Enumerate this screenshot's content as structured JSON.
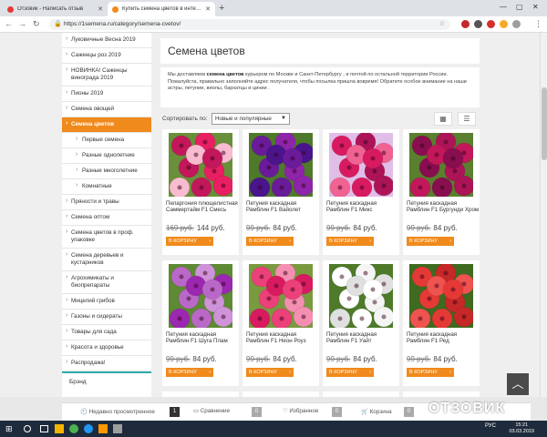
{
  "browser": {
    "tabs": [
      {
        "title": "Отзовик - Написать отзыв",
        "active": false,
        "favicon_color": "#e53935"
      },
      {
        "title": "Купить семена цветов в интер...",
        "active": true,
        "favicon_color": "#f08a1c"
      }
    ],
    "url": "https://1semena.ru/category/semena-cvetov/",
    "accent": "#f08a1c"
  },
  "sidebar": {
    "items": [
      {
        "label": "Луковичные Весна 2019",
        "active": false,
        "sub": false
      },
      {
        "label": "Саженцы роз 2019",
        "active": false,
        "sub": false
      },
      {
        "label": "НОВИНКА! Саженцы винограда 2019",
        "active": false,
        "sub": false
      },
      {
        "label": "Пионы 2019",
        "active": false,
        "sub": false
      },
      {
        "label": "Семена овощей",
        "active": false,
        "sub": false
      },
      {
        "label": "Семена цветов",
        "active": true,
        "sub": false
      },
      {
        "label": "Первые семена",
        "active": false,
        "sub": true
      },
      {
        "label": "Разные однолетние",
        "active": false,
        "sub": true
      },
      {
        "label": "Разные многолетние",
        "active": false,
        "sub": true
      },
      {
        "label": "Комнатные",
        "active": false,
        "sub": true
      },
      {
        "label": "Пряности и травы",
        "active": false,
        "sub": false
      },
      {
        "label": "Семена оптом",
        "active": false,
        "sub": false
      },
      {
        "label": "Семена цветов в проф. упаковке",
        "active": false,
        "sub": false
      },
      {
        "label": "Семена деревьев и кустарников",
        "active": false,
        "sub": false
      },
      {
        "label": "Агрохимикаты и биопрепараты",
        "active": false,
        "sub": false
      },
      {
        "label": "Мицелий грибов",
        "active": false,
        "sub": false
      },
      {
        "label": "Газоны и сидераты",
        "active": false,
        "sub": false
      },
      {
        "label": "Товары для сада",
        "active": false,
        "sub": false
      },
      {
        "label": "Красота и здоровье",
        "active": false,
        "sub": false
      },
      {
        "label": "Распродажа!",
        "active": false,
        "sub": false
      }
    ],
    "brand_label": "Брэнд"
  },
  "main": {
    "title": "Семена цветов",
    "intro_part1": "Мы доставляем ",
    "intro_bold": "семена цветов",
    "intro_part2": " курьером по Москве и Санкт-Петербургу , и почтой по остальной территории России. Пожалуйста, правильно заполняйте адрес получателя, чтобы посылка пришла вовремя! Обратите особое внимание на наши астры, петунии, виолы, бархатцы и цинии .",
    "sort_label": "Сортировать по:",
    "sort_value": "Новые и популярные",
    "cart_label": "В КОРЗИНУ",
    "products": [
      {
        "name": "Пеларгония плющелистная Саммертайм F1 Смесь",
        "old_price": "169 руб.",
        "price": "144 руб.",
        "palette": [
          "#c2185b",
          "#e91e63",
          "#f8bbd0",
          "#6a8f3a"
        ]
      },
      {
        "name": "Петуния каскадная Рамблин F1 Вайолет",
        "old_price": "99 руб.",
        "price": "84 руб.",
        "palette": [
          "#6a1b9a",
          "#8e24aa",
          "#4a148c",
          "#4e7a2a"
        ]
      },
      {
        "name": "Петуния каскадная Рамблин F1 Микс",
        "old_price": "99 руб.",
        "price": "84 руб.",
        "palette": [
          "#d81b60",
          "#ad1457",
          "#f06292",
          "#e1bee7"
        ]
      },
      {
        "name": "Петуния каскадная Рамблин F1 Бургунди Хром",
        "old_price": "99 руб.",
        "price": "84 руб.",
        "palette": [
          "#880e4f",
          "#ad1457",
          "#c2185b",
          "#5a7f2e"
        ]
      },
      {
        "name": "Петуния каскадная Рамблин F1 Шуга Плам",
        "old_price": "99 руб.",
        "price": "84 руб.",
        "palette": [
          "#ba68c8",
          "#ce93d8",
          "#9c27b0",
          "#5d8a32"
        ]
      },
      {
        "name": "Петуния каскадная Рамблин F1 Неон Роуз",
        "old_price": "99 руб.",
        "price": "84 руб.",
        "palette": [
          "#ec407a",
          "#f48fb1",
          "#d81b60",
          "#7a9a40"
        ]
      },
      {
        "name": "Петуния каскадная Рамблин F1 Уайт",
        "old_price": "99 руб.",
        "price": "84 руб.",
        "palette": [
          "#ffffff",
          "#f5f5f5",
          "#e0e0e0",
          "#4e7a2a"
        ]
      },
      {
        "name": "Петуния каскадная Рамблин F1 Ред",
        "old_price": "99 руб.",
        "price": "84 руб.",
        "palette": [
          "#e53935",
          "#c62828",
          "#ef5350",
          "#3e6b20"
        ]
      }
    ]
  },
  "bottombar": {
    "recent_label": "Недавно просмотренное",
    "recent_count": "1",
    "compare_label": "Сравнение",
    "compare_count": "0",
    "favorites_label": "Избранное",
    "favorites_count": "0",
    "cart_label": "Корзина",
    "cart_count": "0"
  },
  "watermark": "ОТЗОВИК",
  "taskbar": {
    "lang": "РУС",
    "time": "15:21",
    "date": "03.03.2019"
  }
}
